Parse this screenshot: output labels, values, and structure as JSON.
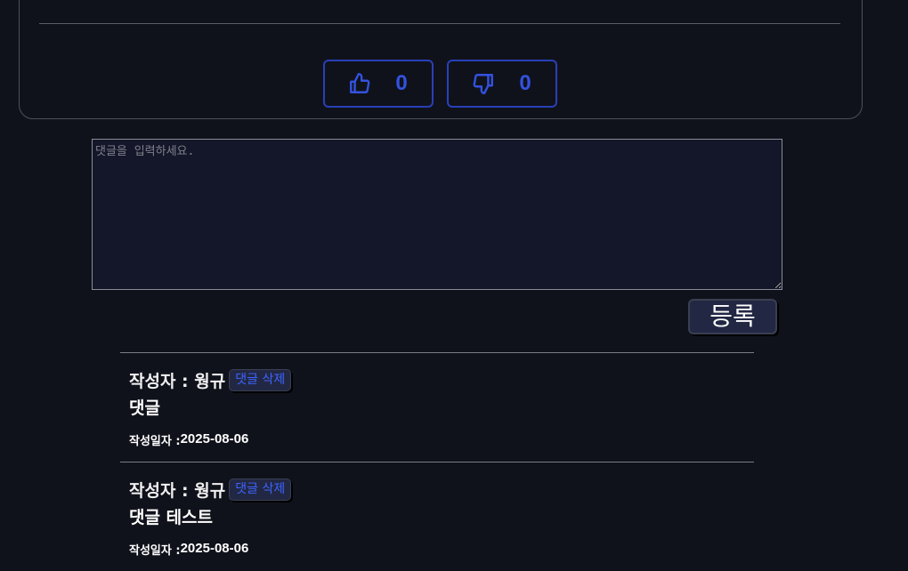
{
  "post": {
    "like": {
      "icon": "thumbs-up-icon",
      "count": "0"
    },
    "dislike": {
      "icon": "thumbs-down-icon",
      "count": "0"
    }
  },
  "comment_form": {
    "placeholder": "댓글을 입력하세요.",
    "value": "",
    "submit_label": "등록"
  },
  "comments": [
    {
      "author_label": "작성자 : 웡규",
      "delete_label": "댓글 삭제",
      "body": "댓글",
      "date_label": "작성일자 : ",
      "date": "2025-08-06"
    },
    {
      "author_label": "작성자 : 웡규",
      "delete_label": "댓글 삭제",
      "body": "댓글 테스트",
      "date_label": "작성일자 : ",
      "date": "2025-08-06"
    }
  ],
  "colors": {
    "background": "#10121b",
    "accent": "#3352e0",
    "button_bg": "#222843",
    "input_bg": "#141729"
  }
}
